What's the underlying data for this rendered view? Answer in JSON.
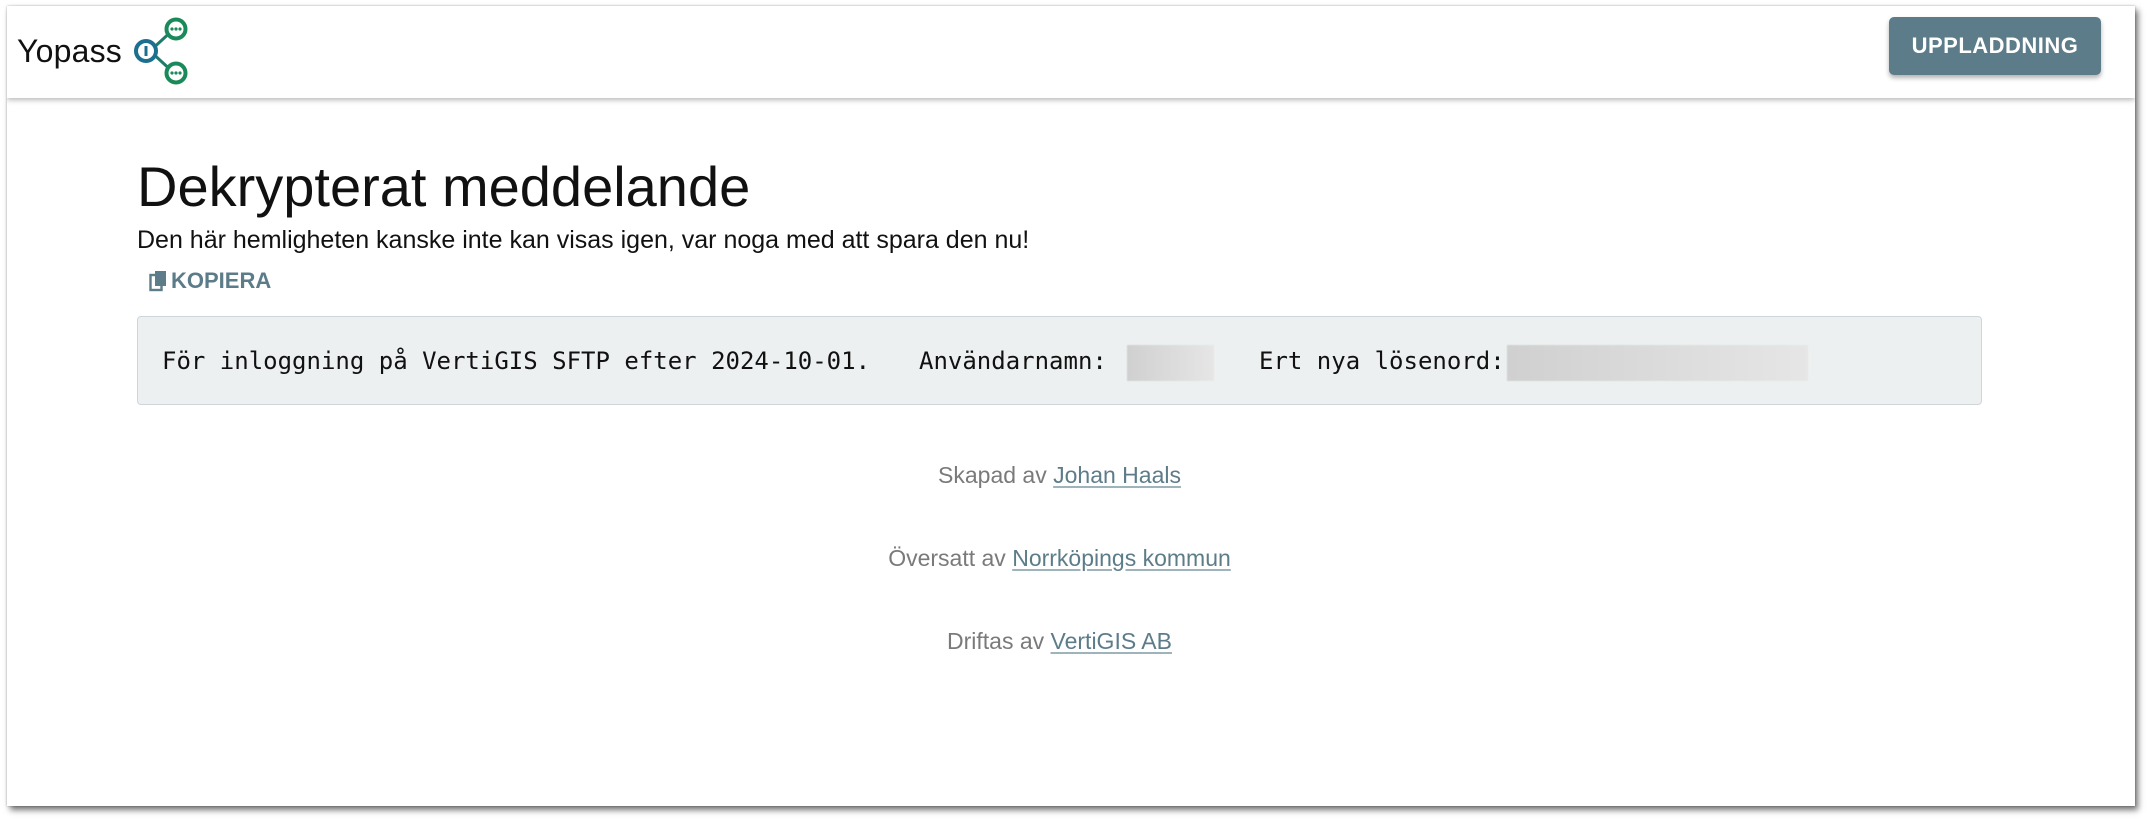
{
  "header": {
    "app_name": "Yopass",
    "logo_icon": "share-nodes-icon",
    "upload_label": "UPPLADDNING",
    "accent_color": "#5d7c89"
  },
  "main": {
    "title": "Dekrypterat meddelande",
    "subtitle": "Den här hemligheten kanske inte kan visas igen, var noga med att spara den nu!",
    "copy_label": "KOPIERA",
    "copy_icon": "copy-icon",
    "secret": {
      "part1": "För inloggning på VertiGIS SFTP efter 2024-10-01.",
      "username_label": "Användarnamn:",
      "password_label": "Ert nya lösenord:"
    }
  },
  "footer": {
    "created_prefix": "Skapad av",
    "created_link": "Johan Haals",
    "translated_prefix": "Översatt av",
    "translated_link": "Norrköpings kommun",
    "hosted_prefix": "Driftas av",
    "hosted_link": "VertiGIS AB"
  }
}
